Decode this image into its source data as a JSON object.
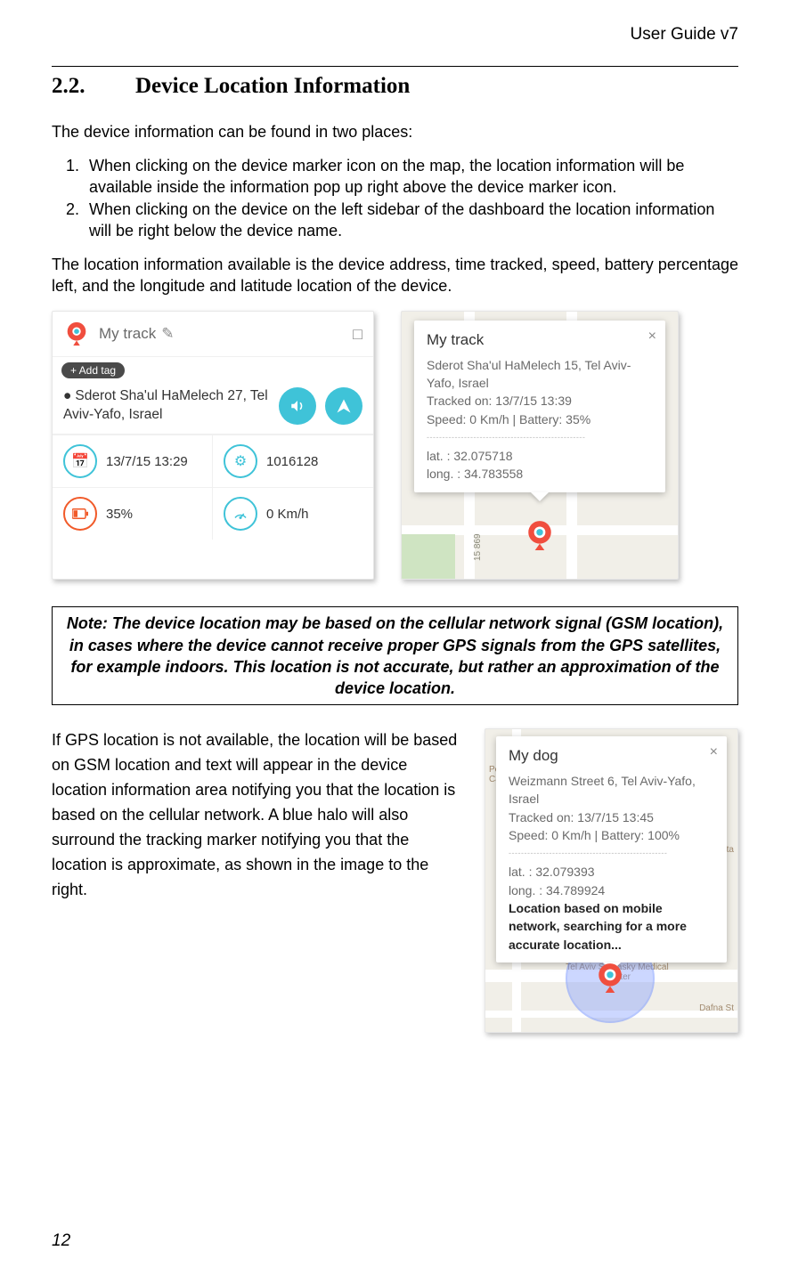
{
  "header": "User Guide v7",
  "section_num": "2.2.",
  "section_title": "Device Location Information",
  "intro": "The device information can be found in two places:",
  "list": [
    "When clicking on the device marker icon on the map, the location information will be available inside the information pop up right above the device marker icon.",
    "When clicking on the device on the left sidebar of the dashboard the location information will be right below the device name."
  ],
  "para2": "The location information available is the device address, time tracked, speed, battery percentage left, and the longitude and latitude location of the device.",
  "fig1": {
    "device_name": "My track",
    "add_tag": "+ Add tag",
    "address": "Sderot Sha'ul HaMelech 27, Tel Aviv-Yafo, Israel",
    "date": "13/7/15 13:29",
    "code": "1016128",
    "battery": "35%",
    "speed": "0 Km/h"
  },
  "fig2": {
    "title": "My track",
    "address": "Sderot Sha'ul HaMelech 15, Tel Aviv-Yafo, Israel",
    "tracked": "Tracked on: 13/7/15 13:39",
    "speed_bat": "Speed: 0 Km/h | Battery: 35%",
    "lat": "lat. : 32.075718",
    "long": "long. : 34.783558",
    "street": "15 869",
    "dash": "---------------------------------------------------"
  },
  "note": "Note: The device location may be based on the cellular network signal (GSM location), in cases where the device cannot receive proper GPS signals from the GPS satellites, for example indoors.  This location is not accurate, but rather an approximation of the device location.",
  "para3": "If GPS location is not available, the location will be based on GSM location and text will appear in the device location information area notifying you that the location is based on the cellular network. A blue halo will also surround the tracking marker notifying you that the location is approximate, as shown in the image to the right.",
  "fig3": {
    "title": "My dog",
    "address": "Weizmann Street 6, Tel Aviv-Yafo, Israel",
    "tracked": "Tracked on: 13/7/15 13:45",
    "speed_bat": "Speed: 0 Km/h | Battery: 100%",
    "lat": "lat. : 32.079393",
    "long": "long. : 34.789924",
    "based": "Location based on mobile network, searching for a more accurate location...",
    "poi1": "Pediatric Cardiology",
    "poi2": "Tel Aviv Sourasky Medical Center",
    "poi3": "Henrietta",
    "poi4": "Dafna St",
    "dash": "---------------------------------------------------"
  },
  "page_number": "12"
}
